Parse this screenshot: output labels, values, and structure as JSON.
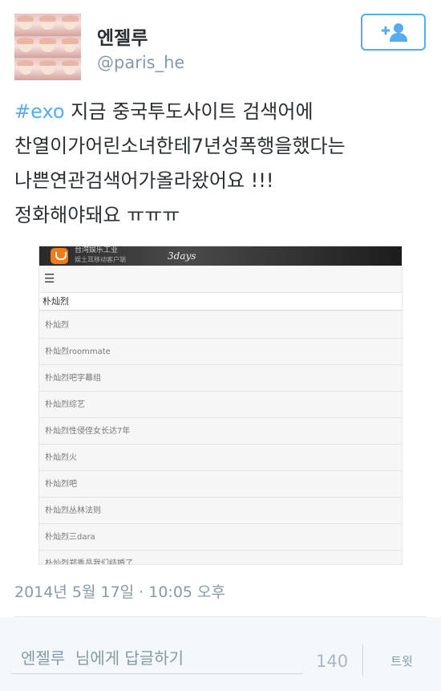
{
  "user": {
    "display_name": "엔젤루",
    "handle": "@paris_he"
  },
  "follow_button": {
    "icon": "follow-icon",
    "color": "#55acee"
  },
  "tweet": {
    "hashtag": "#exo",
    "lines": [
      " 지금 중국투도사이트 검색어에",
      "찬열이가어린소녀한테7년성폭행을했다는",
      "나쁜연관검색어가올라왔어요 !!!",
      "정화해야돼요 ㅠㅠㅠ"
    ],
    "timestamp": "2014년 5월 17일 · 10:05 오후"
  },
  "media": {
    "app_title": "台湾娱乐工业",
    "app_sub": "娱土耳移动客户端",
    "badge": "3days",
    "search_value": "朴灿烈",
    "suggestions": [
      "朴灿烈",
      "朴灿烈roommate",
      "朴灿烈吧字幕组",
      "朴灿烈综艺",
      "朴灿烈性侵侄女长达7年",
      "朴灿烈火",
      "朴灿烈吧",
      "朴灿烈丛林法则",
      "朴灿烈三dara",
      "朴灿烈郑秀晶我们结婚了"
    ]
  },
  "reply": {
    "placeholder": "엔젤루  님에게 답글하기",
    "char_count": "140",
    "tweet_button": "트윗"
  },
  "colors": {
    "accent": "#55acee",
    "text": "#292f33",
    "muted": "#8899a6"
  }
}
